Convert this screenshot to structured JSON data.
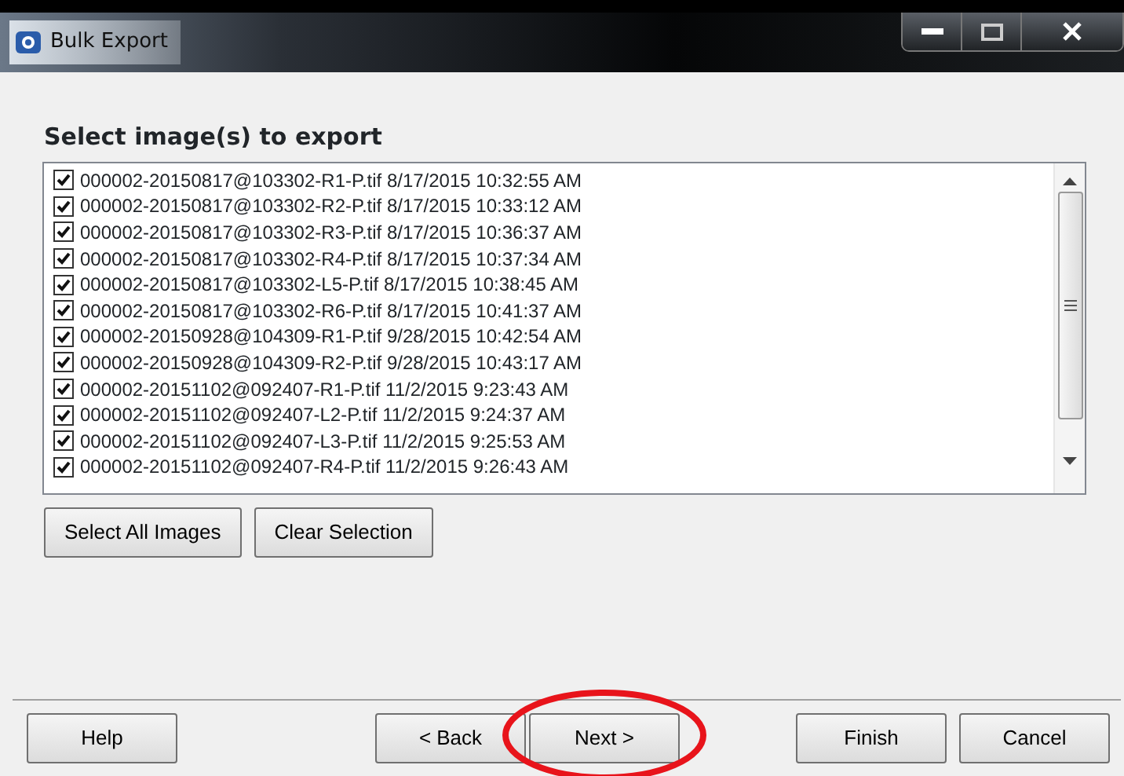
{
  "window": {
    "title": "Bulk Export"
  },
  "heading": "Select image(s) to export",
  "images": [
    {
      "label": "000002-20150817@103302-R1-P.tif 8/17/2015 10:32:55 AM",
      "checked": true
    },
    {
      "label": "000002-20150817@103302-R2-P.tif 8/17/2015 10:33:12 AM",
      "checked": true
    },
    {
      "label": "000002-20150817@103302-R3-P.tif 8/17/2015 10:36:37 AM",
      "checked": true
    },
    {
      "label": "000002-20150817@103302-R4-P.tif 8/17/2015 10:37:34 AM",
      "checked": true
    },
    {
      "label": "000002-20150817@103302-L5-P.tif 8/17/2015 10:38:45 AM",
      "checked": true
    },
    {
      "label": "000002-20150817@103302-R6-P.tif 8/17/2015 10:41:37 AM",
      "checked": true
    },
    {
      "label": "000002-20150928@104309-R1-P.tif 9/28/2015 10:42:54 AM",
      "checked": true
    },
    {
      "label": "000002-20150928@104309-R2-P.tif 9/28/2015 10:43:17 AM",
      "checked": true
    },
    {
      "label": "000002-20151102@092407-R1-P.tif 11/2/2015 9:23:43 AM",
      "checked": true
    },
    {
      "label": "000002-20151102@092407-L2-P.tif 11/2/2015 9:24:37 AM",
      "checked": true
    },
    {
      "label": "000002-20151102@092407-L3-P.tif 11/2/2015 9:25:53 AM",
      "checked": true
    },
    {
      "label": "000002-20151102@092407-R4-P.tif 11/2/2015 9:26:43 AM",
      "checked": true
    }
  ],
  "list_buttons": [
    "Select All Images",
    "Clear Selection"
  ],
  "footer_buttons": [
    {
      "label": "Help",
      "highlighted": false
    },
    {
      "label": "< Back",
      "highlighted": false
    },
    {
      "label": "Next >",
      "highlighted": true
    },
    {
      "label": "Finish",
      "highlighted": false
    },
    {
      "label": "Cancel",
      "highlighted": false
    }
  ]
}
